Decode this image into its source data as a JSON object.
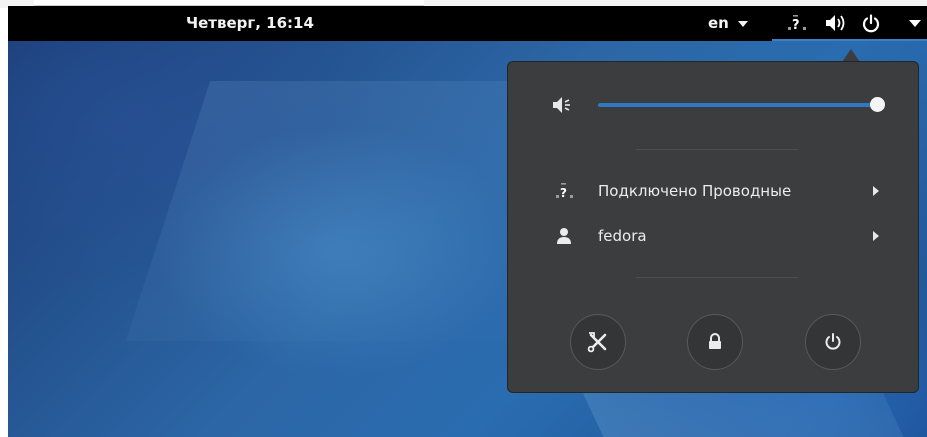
{
  "panel": {
    "clock": "Четверг, 16:14",
    "language": "en",
    "icons": [
      "network-wired-no-route-icon",
      "volume-high-icon",
      "power-icon",
      "chevron-down-icon"
    ]
  },
  "menu": {
    "volume": {
      "level": 1.0,
      "icon": "volume-icon"
    },
    "network": {
      "label": "Подключено Проводные",
      "icon": "network-wired-no-route-icon"
    },
    "user": {
      "label": "fedora",
      "icon": "user-icon"
    },
    "buttons": [
      {
        "icon": "settings-icon"
      },
      {
        "icon": "lock-icon"
      },
      {
        "icon": "power-off-icon"
      }
    ]
  },
  "colors": {
    "panel": "#000000",
    "menu_bg": "#3b3d3f",
    "accent": "#2f79c2",
    "text": "#ececec"
  }
}
